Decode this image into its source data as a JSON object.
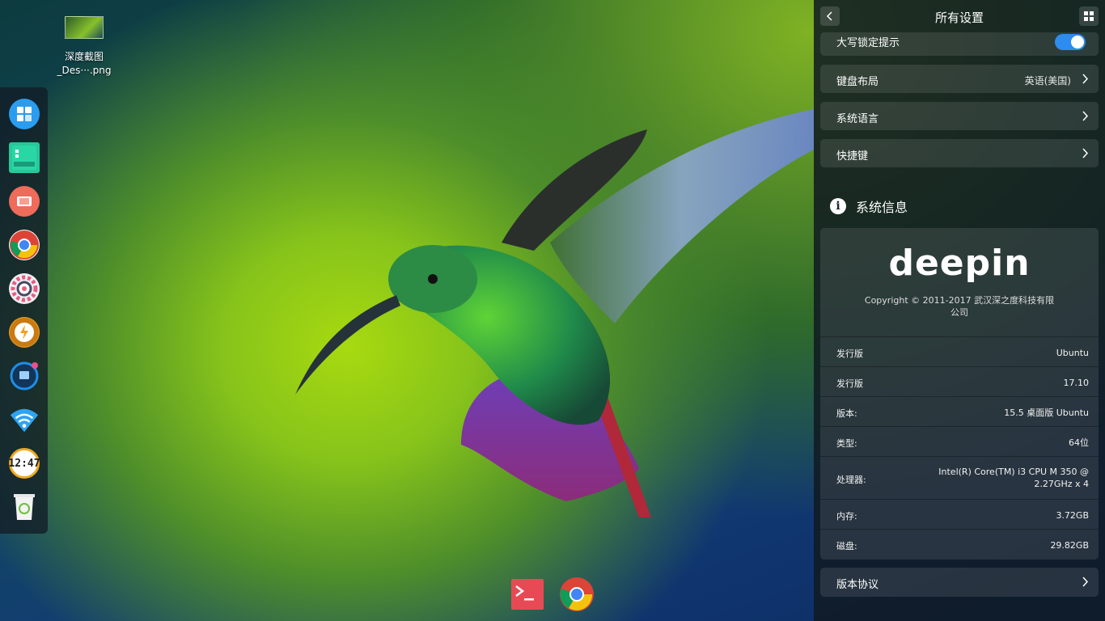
{
  "desktop": {
    "file": {
      "name_line1": "深度截图",
      "name_line2": "_Des···.png"
    }
  },
  "left_dock": {
    "apps": [
      {
        "name": "launcher",
        "icon": "launcher-icon",
        "color": "#2b9df0"
      },
      {
        "name": "file-manager",
        "icon": "file-manager-icon",
        "color": "#27c89a"
      },
      {
        "name": "screen-recorder",
        "icon": "screen-recorder-icon",
        "color": "#ef6b5a"
      },
      {
        "name": "google-chrome",
        "icon": "chrome-icon",
        "color": "#4285f4"
      },
      {
        "name": "control-center",
        "icon": "settings-icon",
        "color": "#e85d7e"
      },
      {
        "name": "deepin-store",
        "icon": "store-icon",
        "color": "#f0a020"
      },
      {
        "name": "app-store",
        "icon": "deepin-app-icon",
        "color": "#1f8ee8"
      },
      {
        "name": "network",
        "icon": "wifi-icon",
        "color": "#2ea4f2"
      },
      {
        "name": "clock",
        "icon": "clock-icon",
        "time": "12:47"
      },
      {
        "name": "trash",
        "icon": "trash-icon"
      }
    ]
  },
  "bottom_dock": {
    "apps": [
      {
        "name": "terminal",
        "icon": "terminal-icon",
        "color": "#e84a55"
      },
      {
        "name": "google-chrome",
        "icon": "chrome-icon"
      }
    ]
  },
  "control_center": {
    "title": "所有设置",
    "rows": {
      "capslock": {
        "label": "大写锁定提示",
        "enabled": true
      },
      "keyboard_layout": {
        "label": "键盘布局",
        "value": "英语(美国)"
      },
      "system_language": {
        "label": "系统语言"
      },
      "shortcuts": {
        "label": "快捷键"
      }
    },
    "system_info": {
      "section_title": "系统信息",
      "logo_text": "deepin",
      "copyright_line1": "Copyright © 2011-2017 武汉深之度科技有限",
      "copyright_line2": "公司",
      "items": [
        {
          "key": "发行版",
          "value": "Ubuntu"
        },
        {
          "key": "发行版",
          "value": "17.10"
        },
        {
          "key": "版本:",
          "value": "15.5 桌面版 Ubuntu"
        },
        {
          "key": "类型:",
          "value": "64位"
        },
        {
          "key": "处理器:",
          "value_line1": "Intel(R) Core(TM) i3 CPU M 350 @",
          "value_line2": "2.27GHz x 4"
        },
        {
          "key": "内存:",
          "value": "3.72GB"
        },
        {
          "key": "磁盘:",
          "value": "29.82GB"
        }
      ]
    },
    "license_row": {
      "label": "版本协议"
    }
  }
}
